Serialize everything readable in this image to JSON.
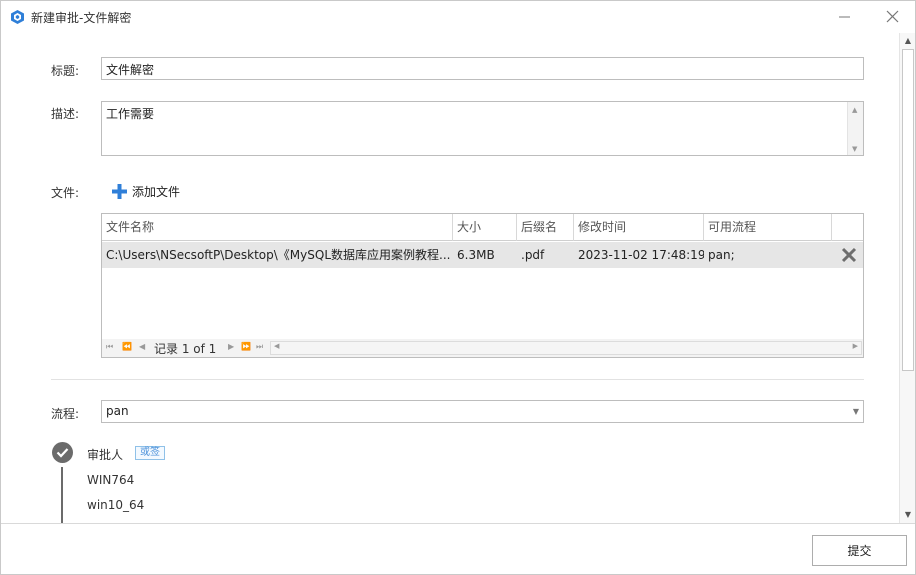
{
  "window": {
    "title": "新建审批-文件解密",
    "brand_color": "#2f7fd8"
  },
  "form": {
    "title_label": "标题:",
    "title_value": "文件解密",
    "desc_label": "描述:",
    "desc_value": "工作需要",
    "file_label": "文件:",
    "add_file_label": "添加文件",
    "flow_label": "流程:",
    "flow_value": "pan"
  },
  "file_table": {
    "columns": [
      "文件名称",
      "大小",
      "后缀名",
      "修改时间",
      "可用流程"
    ],
    "rows": [
      {
        "name": "C:\\Users\\NSecsoftP\\Desktop\\《MySQL数据库应用案例教程...",
        "size": "6.3MB",
        "ext": ".pdf",
        "modified": "2023-11-02 17:48:19",
        "flow": "pan;"
      }
    ],
    "record_text": "记录 1 of 1",
    "selected_row_color": "#e6e6e6"
  },
  "approval": {
    "step_title": "审批人",
    "mode_badge": "或签",
    "approvers": [
      "WIN764",
      "win10_64"
    ]
  },
  "footer": {
    "submit_label": "提交"
  }
}
